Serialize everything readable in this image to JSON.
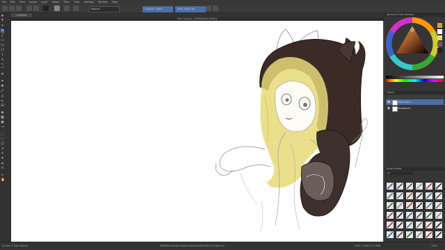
{
  "menu": [
    "File",
    "Edit",
    "View",
    "Image",
    "Layer",
    "Select",
    "Filter",
    "Tools",
    "Settings",
    "Window",
    "Help"
  ],
  "toolbar": {
    "blend_mode": "Normal",
    "brush_preset": "Opacity: 100%",
    "size_field": "Size: 40.00 px"
  },
  "tabs": [
    "Untitled",
    "[Not Saved] - [RGB/Alpha (8-bit)]"
  ],
  "canvas_subtitle": "[Not Saved] - [RGB/Alpha (8-bit)]",
  "dock": {
    "color_panel_title": "Advanced Color Selector",
    "layers_title": "Layers",
    "layers": [
      {
        "name": "Paint Layer 1",
        "selected": true
      },
      {
        "name": "Background",
        "selected": false
      }
    ],
    "presets_title": "Brush Presets",
    "presets_filter": "All"
  },
  "status": {
    "left": "b) Basic-5 Size Opacity",
    "center": "RGB/Alpha (8-bit integer/channel)  sRGB-elle-V2-srgbtrc.icc",
    "right": "1920 x 1080 (21.1 MiB)",
    "zoom": "100%"
  },
  "colors": {
    "accent": "#4a6fa5",
    "canvas_bg": "#ffffff",
    "ui_bg": "#2f2f2f",
    "hair": "#e8d97a",
    "hood": "#3b2b26"
  },
  "icons": [
    "freehand-brush-icon",
    "select-icon",
    "move-icon",
    "eraser-icon",
    "fill-icon",
    "gradient-icon",
    "text-icon",
    "zoom-icon",
    "eye-icon"
  ]
}
